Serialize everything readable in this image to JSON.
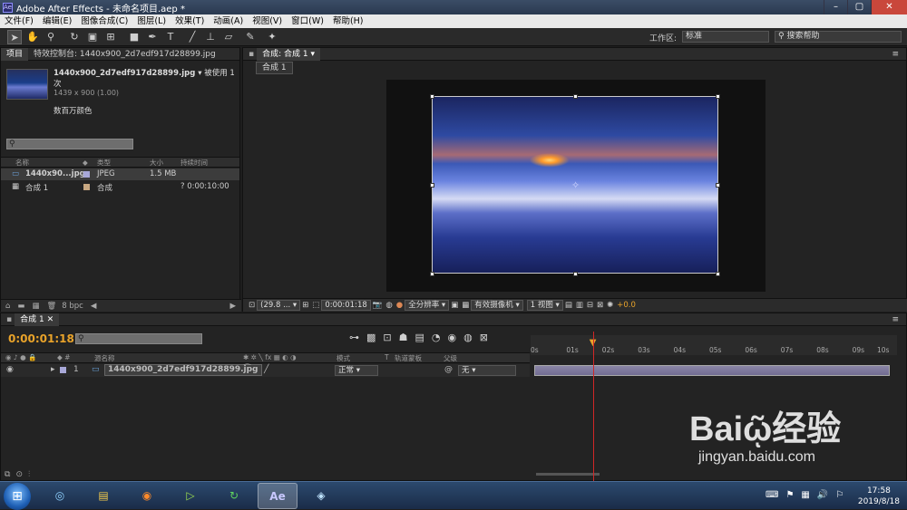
{
  "window": {
    "title": "Adobe After Effects - 未命名项目.aep *",
    "app_icon": "Ae"
  },
  "menu": [
    "文件(F)",
    "编辑(E)",
    "图像合成(C)",
    "图层(L)",
    "效果(T)",
    "动画(A)",
    "视图(V)",
    "窗口(W)",
    "帮助(H)"
  ],
  "toolbar": {
    "workspace_label": "工作区:",
    "workspace_value": "标准",
    "help_search": "搜索帮助"
  },
  "project": {
    "tabs": [
      "项目",
      "特效控制台: 1440x900_2d7edf917d28899.jpg"
    ],
    "file_name": "1440x900_2d7edf917d28899.jpg ▾",
    "used": "被使用 1次",
    "dimensions": "1439 x 900 (1.00)",
    "color": "数百万颜色",
    "columns": [
      "名称",
      "类型",
      "大小",
      "持续时间"
    ],
    "items": [
      {
        "name": "1440x90...jpg",
        "type": "JPEG",
        "size": "1.5 MB",
        "duration": ""
      },
      {
        "name": "合成 1",
        "type": "合成",
        "size": "",
        "duration": "? 0:00:10:00"
      }
    ],
    "bpc": "8 bpc"
  },
  "composition": {
    "tab": "合成: 合成 1",
    "subtab": "合成 1",
    "zoom": "(29.8 ...",
    "timecode": "0:00:01:18",
    "resolution": "全分辨率",
    "camera": "有效摄像机",
    "views": "1 视图",
    "exposure": "+0.0"
  },
  "timeline": {
    "tab": "合成 1",
    "timecode": "0:00:01:18",
    "columns": {
      "source": "源名称",
      "mode": "模式",
      "t": "T",
      "trkmat": "轨道蒙板",
      "parent": "父级"
    },
    "layer": {
      "index": "1",
      "name": "1440x900_2d7edf917d28899.jpg",
      "mode": "正常",
      "parent": "无"
    },
    "ruler": [
      "0s",
      "01s",
      "02s",
      "03s",
      "04s",
      "05s",
      "06s",
      "07s",
      "08s",
      "09s",
      "10s"
    ],
    "playhead_seconds": 1.72
  },
  "taskbar": {
    "time": "17:58",
    "date": "2019/8/18"
  },
  "watermark": {
    "brand": "Bai",
    "brand2": "经验",
    "url": "jingyan.baidu.com"
  }
}
